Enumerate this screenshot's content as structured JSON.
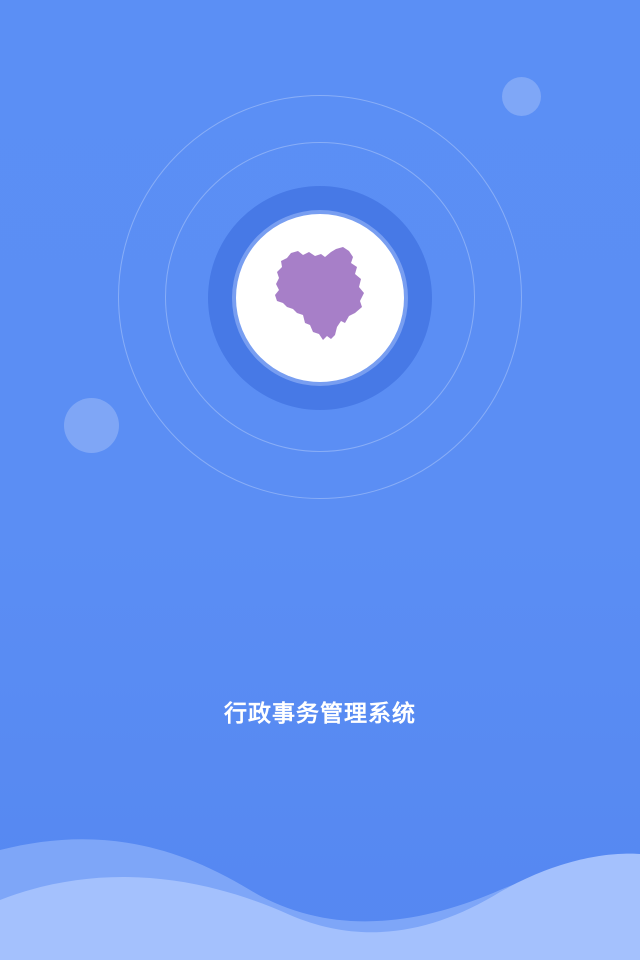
{
  "splash": {
    "app_title": "行政事务管理系统"
  },
  "logo": {
    "icon": "region-map-icon",
    "map_color": "#a77fc8",
    "halo_color": "#4779e6",
    "disc_color": "#ffffff"
  },
  "theme": {
    "background_color": "#5b8ff5",
    "wave_color_light": "#a4c1fd",
    "wave_color_mid": "#7ea6f8"
  }
}
